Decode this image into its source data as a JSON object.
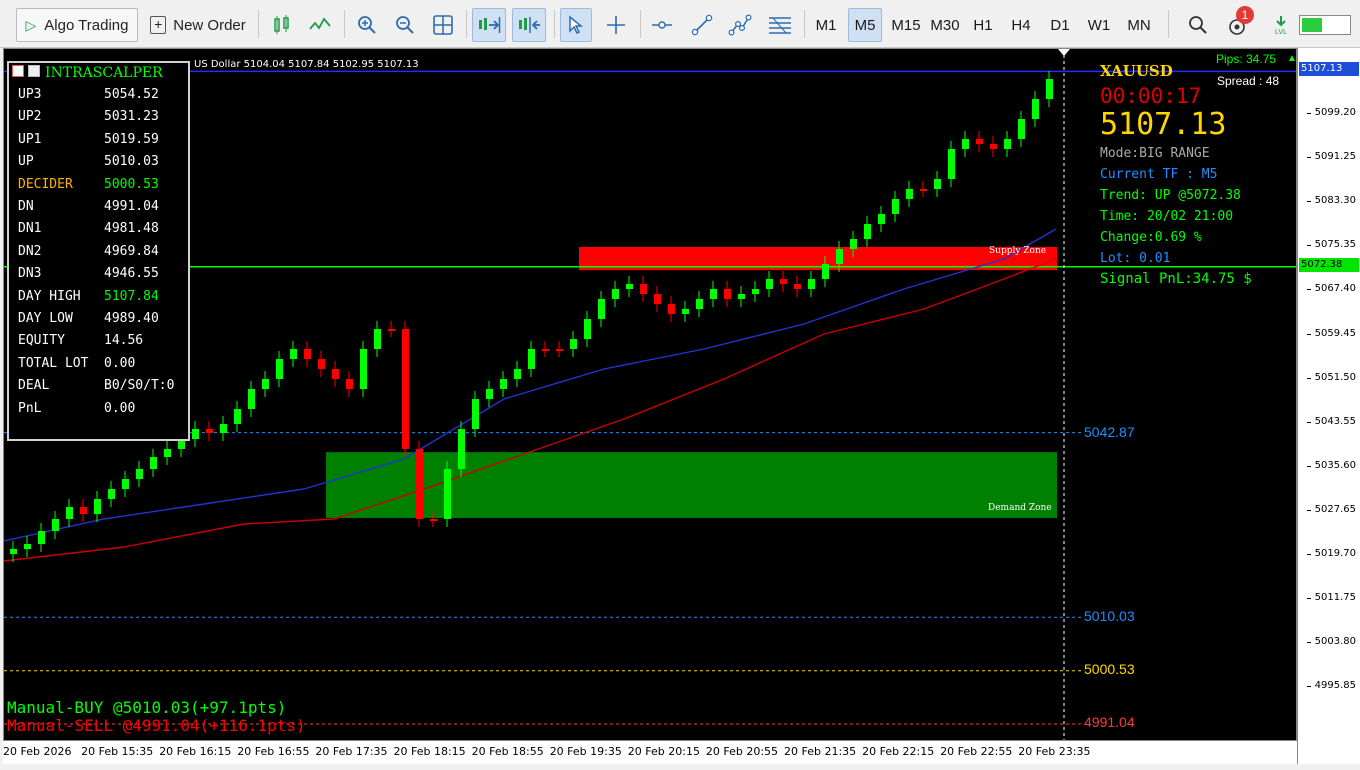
{
  "toolbar": {
    "algo_trading_label": "Algo Trading",
    "new_order_label": "New Order",
    "timeframes": [
      "M1",
      "M5",
      "M15",
      "M30",
      "H1",
      "H4",
      "D1",
      "W1",
      "MN"
    ],
    "active_timeframe": "M5",
    "notification_count": "1",
    "signal_label": "LVL"
  },
  "chart": {
    "header_partial": "US Dollar  5104.04 5107.84 5102.95 5107.13",
    "symbol": "XAUUSD",
    "timer": "00:00:17",
    "bid": "5107.13",
    "pips": "Pips: 34.75",
    "spread": "Spread : 48",
    "mode": "Mode:BIG RANGE",
    "current_tf": "Current TF : M5",
    "trend": "Trend: UP @5072.38",
    "time": "Time: 20/02 21:00",
    "change": "Change:0.69 %",
    "lot": "Lot: 0.01",
    "signal_pnl": "Signal PnL:34.75 $",
    "supply_zone": "Supply Zone",
    "demand_zone": "Demand Zone",
    "manual_buy": "Manual-BUY  @5010.03(+97.1pts)",
    "manual_sell": "Manual-SELL @4991.04(+116.1pts)",
    "level_5042": "5042.87",
    "level_5010": "5010.03",
    "level_5000": "5000.53",
    "level_4991": "4991.04",
    "colors": {
      "bull": "#00ff00",
      "bear": "#ff0000",
      "supply": "#ff0000",
      "demand": "#008000",
      "accent": "#ffd700"
    }
  },
  "panel": {
    "title": "INTRASCALPER",
    "rows": [
      {
        "label": "UP3",
        "value": "5054.52"
      },
      {
        "label": "UP2",
        "value": "5031.23"
      },
      {
        "label": "UP1",
        "value": "5019.59"
      },
      {
        "label": "UP",
        "value": "5010.03"
      },
      {
        "label": "DECIDER",
        "value": "5000.53"
      },
      {
        "label": "DN",
        "value": "4991.04"
      },
      {
        "label": "DN1",
        "value": "4981.48"
      },
      {
        "label": "DN2",
        "value": "4969.84"
      },
      {
        "label": "DN3",
        "value": "4946.55"
      },
      {
        "label": "DAY HIGH",
        "value": "5107.84"
      },
      {
        "label": "DAY LOW",
        "value": "4989.40"
      },
      {
        "label": "EQUITY",
        "value": "14.56"
      },
      {
        "label": "TOTAL LOT",
        "value": "0.00"
      },
      {
        "label": "DEAL",
        "value": "B0/S0/T:0"
      },
      {
        "label": "PnL",
        "value": "0.00"
      }
    ]
  },
  "price_axis": {
    "ticks": [
      "5099.20",
      "5091.25",
      "5083.30",
      "5075.35",
      "5067.40",
      "5059.45",
      "5051.50",
      "5043.55",
      "5035.60",
      "5027.65",
      "5019.70",
      "5011.75",
      "5003.80",
      "4995.85"
    ],
    "current_price": "5107.13",
    "trend_price": "5072.38"
  },
  "time_axis": {
    "labels": [
      "20 Feb 2026",
      "20 Feb 15:35",
      "20 Feb 16:15",
      "20 Feb 16:55",
      "20 Feb 17:35",
      "20 Feb 18:15",
      "20 Feb 18:55",
      "20 Feb 19:35",
      "20 Feb 20:15",
      "20 Feb 20:55",
      "20 Feb 21:35",
      "20 Feb 22:15",
      "20 Feb 22:55",
      "20 Feb 23:35"
    ]
  }
}
